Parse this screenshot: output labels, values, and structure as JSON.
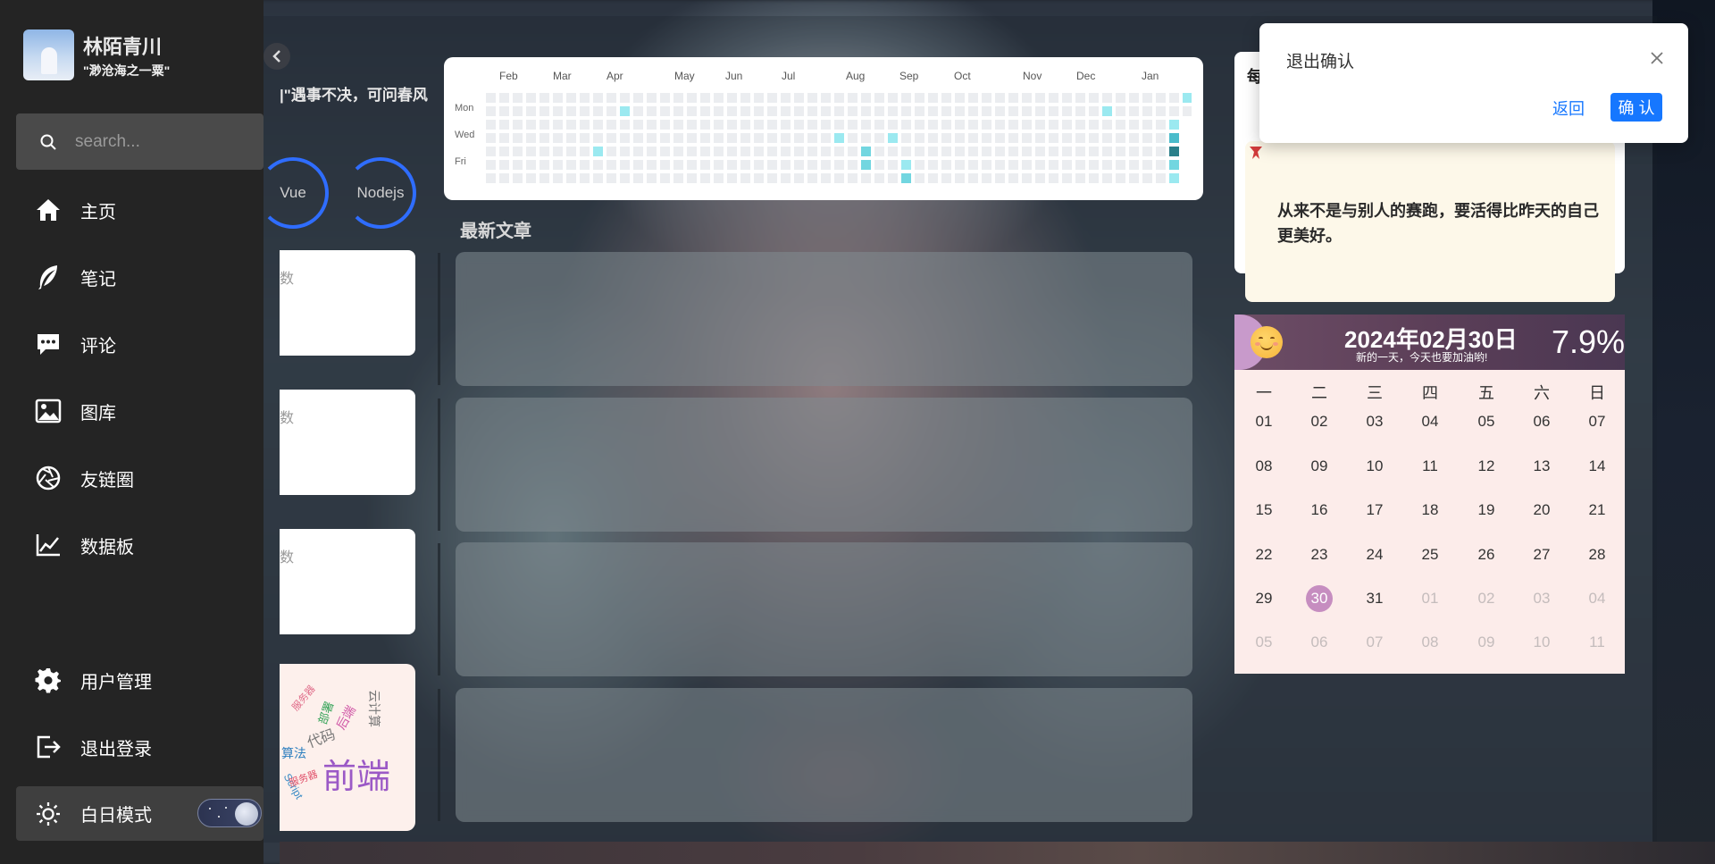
{
  "profile": {
    "name": "林陌青川",
    "motto": "\"渺沧海之一粟\""
  },
  "search": {
    "placeholder": "search..."
  },
  "nav": {
    "items": [
      {
        "label": "主页",
        "icon": "home-icon"
      },
      {
        "label": "笔记",
        "icon": "feather-icon"
      },
      {
        "label": "评论",
        "icon": "comment-icon"
      },
      {
        "label": "图库",
        "icon": "image-icon"
      },
      {
        "label": "友链圈",
        "icon": "aperture-icon"
      },
      {
        "label": "数据板",
        "icon": "chart-line-icon"
      }
    ],
    "bottom": [
      {
        "label": "用户管理",
        "icon": "gear-icon"
      },
      {
        "label": "退出登录",
        "icon": "logout-icon"
      }
    ],
    "mode_label": "白日模式"
  },
  "slogan": "遇事不决，可问春风\"|",
  "rings": [
    "Vue",
    "Nodejs"
  ],
  "side_cards": [
    "数",
    "数",
    "数"
  ],
  "wordcloud": {
    "main": "前端",
    "words": [
      "算法",
      "代码",
      "后端",
      "云计算",
      "服务器",
      "部署",
      "Script",
      "服务器"
    ]
  },
  "heatmap": {
    "months": [
      "Feb",
      "Mar",
      "Apr",
      "May",
      "Jun",
      "Jul",
      "Aug",
      "Sep",
      "Oct",
      "Nov",
      "Dec",
      "Jan"
    ],
    "days": [
      "Mon",
      "Wed",
      "Fri"
    ],
    "colors": {
      "empty": "#ebedf0",
      "l1": "#9be9f0",
      "l2": "#72d6e0",
      "l3": "#4bbccb",
      "l4": "#2a7f8a"
    }
  },
  "articles": {
    "title": "最新文章"
  },
  "quote": {
    "title": "每",
    "text": "从来不是与别人的赛跑，要活得比昨天的自己更美好。"
  },
  "calendar": {
    "date": "2024年02月30日",
    "subtitle": "新的一天，今天也要加油哟!",
    "percent": "7.9%",
    "weekdays": [
      "一",
      "二",
      "三",
      "四",
      "五",
      "六",
      "日"
    ],
    "days": [
      "01",
      "02",
      "03",
      "04",
      "05",
      "06",
      "07",
      "08",
      "09",
      "10",
      "11",
      "12",
      "13",
      "14",
      "15",
      "16",
      "17",
      "18",
      "19",
      "20",
      "21",
      "22",
      "23",
      "24",
      "25",
      "26",
      "27",
      "28",
      "29",
      "30",
      "31",
      "01",
      "02",
      "03",
      "04",
      "05",
      "06",
      "07",
      "08",
      "09",
      "10",
      "11"
    ],
    "today_index": 29,
    "muted_from": 31
  },
  "modal": {
    "title": "退出确认",
    "back": "返回",
    "ok": "确 认"
  }
}
